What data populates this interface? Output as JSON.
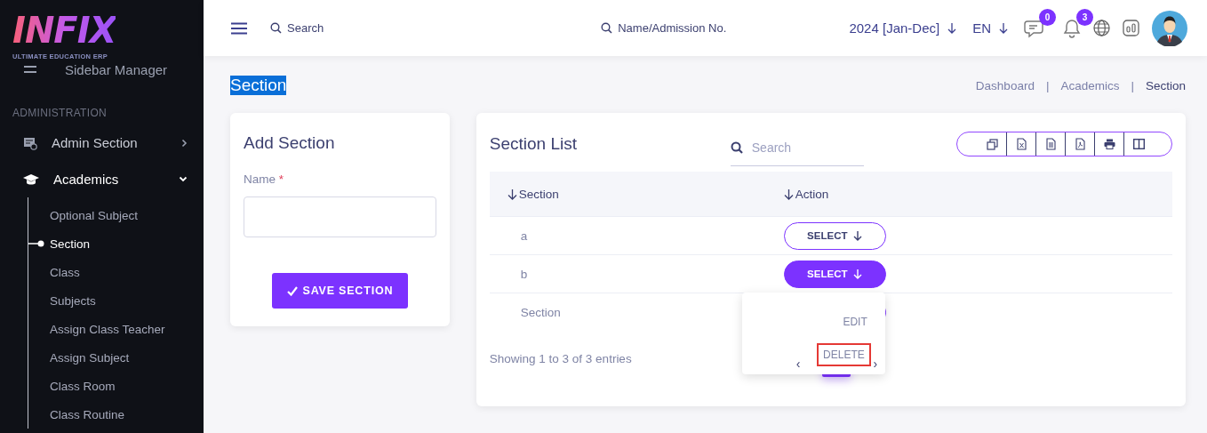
{
  "logo": {
    "name": "INFIX",
    "tagline": "ULTIMATE EDUCATION ERP"
  },
  "sidebar": {
    "cut_item": "Sidebar Manager",
    "group_label": "ADMINISTRATION",
    "items": [
      {
        "label": "Admin Section",
        "expanded": false
      },
      {
        "label": "Academics",
        "expanded": true,
        "children": [
          {
            "label": "Optional Subject",
            "selected": false
          },
          {
            "label": "Section",
            "selected": true
          },
          {
            "label": "Class",
            "selected": false
          },
          {
            "label": "Subjects",
            "selected": false
          },
          {
            "label": "Assign Class Teacher",
            "selected": false
          },
          {
            "label": "Assign Subject",
            "selected": false
          },
          {
            "label": "Class Room",
            "selected": false
          },
          {
            "label": "Class Routine",
            "selected": false
          }
        ]
      }
    ]
  },
  "header": {
    "search": "Search",
    "student_search": "Name/Admission No.",
    "session": "2024 [Jan-Dec]",
    "language": "EN",
    "message_count": "0",
    "notification_count": "3"
  },
  "page": {
    "title": "Section",
    "title_selected": true,
    "breadcrumb": [
      "Dashboard",
      "Academics",
      "Section"
    ],
    "separator": "|"
  },
  "add_form": {
    "title": "Add Section",
    "field_label": "Name",
    "required_mark": "*",
    "button": "SAVE SECTION"
  },
  "list": {
    "title": "Section List",
    "search_placeholder": "Search",
    "columns": [
      "Section",
      "Action"
    ],
    "rows": [
      {
        "section": "a",
        "action": "SELECT",
        "open": false
      },
      {
        "section": "b",
        "action": "SELECT",
        "open": true
      },
      {
        "section": "Section",
        "open": false
      }
    ],
    "menu": [
      {
        "label": "EDIT",
        "highlighted": false
      },
      {
        "label": "DELETE",
        "highlighted": true
      }
    ],
    "footer": "Showing 1 to 3 of 3 entries",
    "prev": "‹",
    "next": "›"
  }
}
